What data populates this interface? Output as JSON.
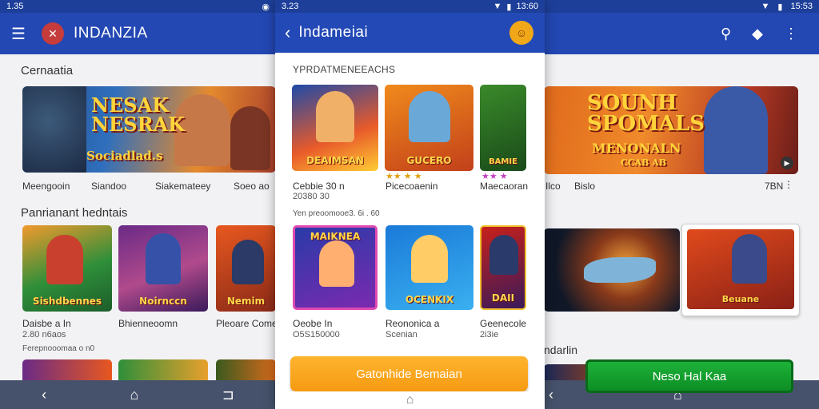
{
  "left": {
    "status_time": "1.35",
    "app_title": "INDANZIA",
    "section1": "Cernaatia",
    "banner_text": "NESAK\nNESRAK",
    "banner_sub": "Sociadlad.s",
    "banner_labels": [
      "Meengooin",
      "Siandoo",
      "Siakemateey",
      "Soeo ao"
    ],
    "section2": "Panrianant hedntais",
    "tiles": [
      {
        "cap": "Sishdbennes"
      },
      {
        "cap": "Noirnccn"
      },
      {
        "cap": "Nemim"
      }
    ],
    "tile_labels": [
      "Daisbe a In",
      "Bhienneoomn",
      "Pleoare Comerac"
    ],
    "tile_sub": "2.80  n6aos",
    "tile_sub2": "Ferepnooomaa  o n0"
  },
  "card": {
    "status_time": "3.23",
    "status_right": "13:60",
    "title": "Indameiai",
    "heading": "YPRDATMENEEACHS",
    "row1": [
      {
        "cap": "DEAIMSAN",
        "title": "Cebbie 30 n",
        "sub": "20380 30"
      },
      {
        "cap": "GUCERO",
        "title": "Picecoaenin"
      },
      {
        "cap": "BAMIE",
        "title": "Maecaoran"
      }
    ],
    "mid_meta": "Yen preoomooe3. 6i . 60",
    "row2": [
      {
        "cap": "MAIKNEA",
        "title": "Oeobe In",
        "sub": "O5S150000"
      },
      {
        "cap": "OCENKIX",
        "title": "Reononica a",
        "sub": "Scenian"
      },
      {
        "cap": "DAII",
        "title": "Geenecole",
        "sub": "2i3ie"
      }
    ],
    "cta": "Gatonhide Bemaian"
  },
  "right": {
    "status_time": "15:53",
    "banner_text": "SOUNH\nSPOMALS",
    "banner_sub": "MENONALN",
    "banner_sub2": "CCAB AB",
    "labels": [
      "Ilco",
      "Bislo",
      "7BN"
    ],
    "section": "ndarlin",
    "cta": "Neso Hal Kaa"
  },
  "colors": {
    "appbar": "#2347b3",
    "cta_orange": "#f59a12",
    "cta_green": "#0c8a23"
  }
}
